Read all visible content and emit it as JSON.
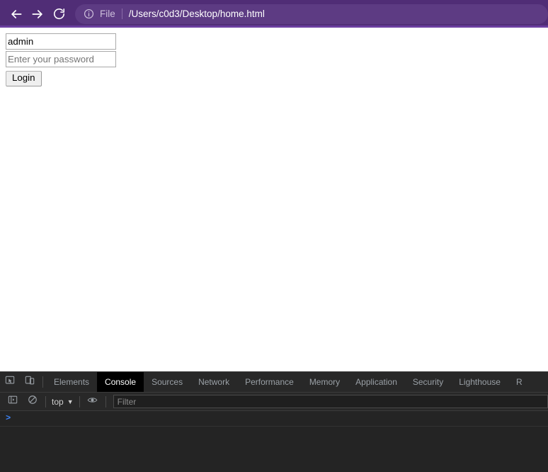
{
  "browser": {
    "nav": {
      "back_icon": "arrow-left-icon",
      "forward_icon": "arrow-right-icon",
      "reload_icon": "reload-icon"
    },
    "omnibox": {
      "info_icon": "info-circle-icon",
      "scheme_label": "File",
      "url": "/Users/c0d3/Desktop/home.html"
    },
    "toolbar_color": "#502d76",
    "omnibox_color": "#5d3b83"
  },
  "page": {
    "form": {
      "username_value": "admin",
      "username_placeholder": "",
      "password_value": "",
      "password_placeholder": "Enter your password",
      "login_label": "Login"
    }
  },
  "devtools": {
    "toolbar_icons": {
      "inspect_icon": "inspect-element-icon",
      "device_toolbar_icon": "device-toggle-icon"
    },
    "tabs": [
      {
        "label": "Elements",
        "active": false
      },
      {
        "label": "Console",
        "active": true
      },
      {
        "label": "Sources",
        "active": false
      },
      {
        "label": "Network",
        "active": false
      },
      {
        "label": "Performance",
        "active": false
      },
      {
        "label": "Memory",
        "active": false
      },
      {
        "label": "Application",
        "active": false
      },
      {
        "label": "Security",
        "active": false
      },
      {
        "label": "Lighthouse",
        "active": false
      },
      {
        "label": "R",
        "active": false
      }
    ],
    "console_toolbar": {
      "sidebar_icon": "console-sidebar-icon",
      "clear_icon": "clear-console-icon",
      "context": "top",
      "context_caret": "▼",
      "eye_icon": "live-expression-eye-icon",
      "filter_placeholder": "Filter",
      "filter_value": ""
    },
    "console": {
      "prompt": ">"
    }
  }
}
